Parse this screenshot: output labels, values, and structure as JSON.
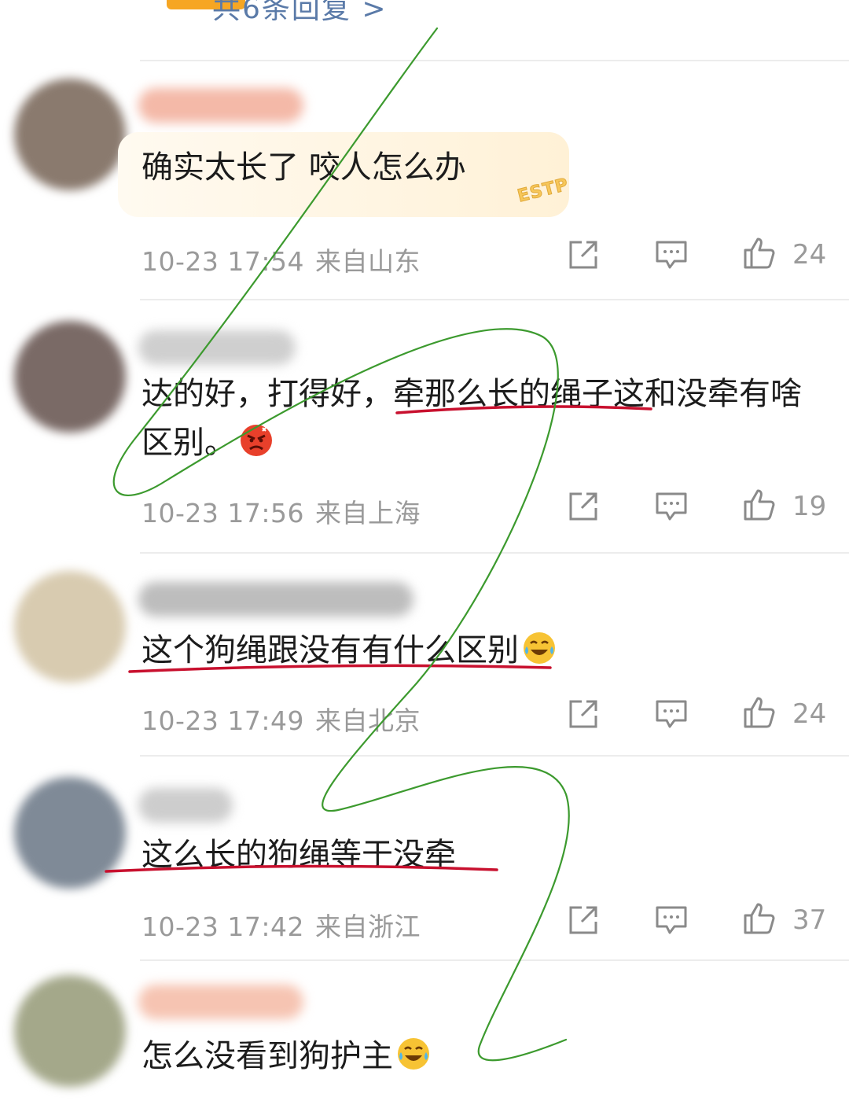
{
  "header": {
    "reply_link": "共6条回复 >"
  },
  "comments": [
    {
      "text": "确实太长了 咬人怎么办",
      "badge": "ESTP",
      "date": "10-23 17:54",
      "location": "来自山东",
      "likes": "24",
      "avatar_color": "#8a7a6e",
      "name_color": "#f4b9a8"
    },
    {
      "text": "达的好，打得好，牵那么长的绳子这和没牵有啥区别。",
      "date": "10-23 17:56",
      "location": "来自上海",
      "likes": "19",
      "avatar_color": "#7a6a66",
      "name_color": "#cfcfcf"
    },
    {
      "text": "这个狗绳跟没有有什么区别",
      "date": "10-23 17:49",
      "location": "来自北京",
      "likes": "24",
      "avatar_color": "#d8cbb0",
      "name_color": "#bdbdbd"
    },
    {
      "text": "这么长的狗绳等于没牵",
      "date": "10-23 17:42",
      "location": "来自浙江",
      "likes": "37",
      "avatar_color": "#7f8a97",
      "name_color": "#cdcdcd"
    },
    {
      "text": "怎么没看到狗护主",
      "avatar_color": "#a4a88a",
      "name_color": "#f6c4b2"
    }
  ],
  "icons": {
    "share": "share-icon",
    "comment": "comment-icon",
    "like": "thumbs-up-icon",
    "angry": "angry-face-emoji",
    "laugh": "laugh-cry-emoji"
  },
  "colors": {
    "accent": "#f6a623",
    "meta": "#9a9a9a",
    "underline": "#c8102e",
    "scribble": "#3c9a2e"
  }
}
